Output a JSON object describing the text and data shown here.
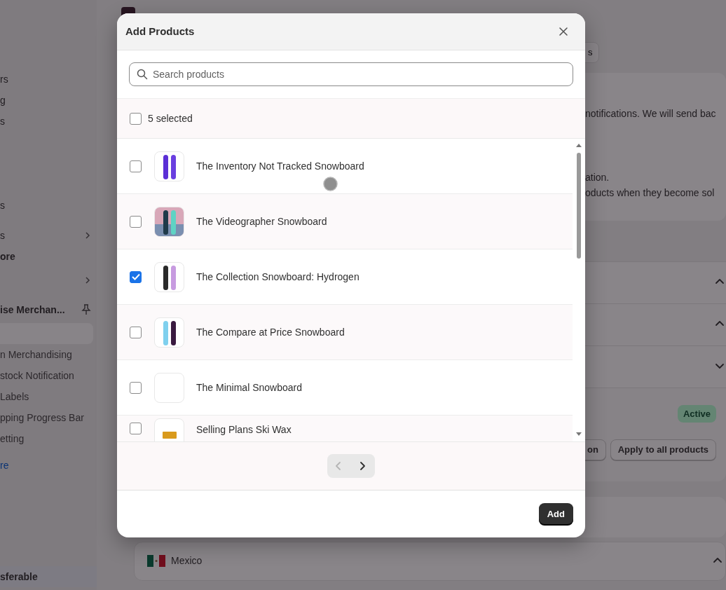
{
  "background": {
    "sidebar_sections": [
      {
        "items": [
          {
            "label": "rs",
            "kind": "item"
          },
          {
            "label": "g",
            "kind": "item"
          },
          {
            "label": "s",
            "kind": "item"
          }
        ]
      },
      {
        "items": [
          {
            "label": "s",
            "kind": "item"
          }
        ]
      },
      {
        "items": [
          {
            "label": "s",
            "kind": "expand"
          },
          {
            "label": "ore",
            "kind": "bold"
          }
        ]
      },
      {
        "items": [
          {
            "kind": "expand"
          },
          {
            "label": "ise Merchan...",
            "kind": "app"
          },
          {
            "kind": "current"
          },
          {
            "label": "n Merchandising",
            "kind": "sub"
          },
          {
            "label": "stock Notification",
            "kind": "sub"
          },
          {
            "label": "Labels",
            "kind": "sub"
          },
          {
            "label": "pping Progress Bar",
            "kind": "sub"
          },
          {
            "label": "etting",
            "kind": "sub"
          }
        ]
      },
      {
        "items": [
          {
            "label": "re",
            "kind": "link"
          }
        ]
      },
      {
        "items": [
          {
            "label": "sferable",
            "kind": "current-bold"
          }
        ]
      }
    ],
    "page_button": "s",
    "notice_lines": [
      "notifications. We will send bac",
      "ation.",
      "oducts when they become sol"
    ],
    "sections": [
      {
        "expanded": true
      },
      {
        "expanded": true
      },
      {
        "expanded": false
      }
    ],
    "status_badge": "Active",
    "buttons": [
      "on",
      "Apply to all products"
    ],
    "country": "Mexico"
  },
  "modal": {
    "title": "Add Products",
    "search": {
      "placeholder": "Search products"
    },
    "select_all": {
      "checked": false,
      "label": "5 selected"
    },
    "products": [
      {
        "name": "The Inventory Not Tracked Snowboard",
        "checked": false,
        "kind": "picture"
      },
      {
        "name": "The Videographer Snowboard",
        "checked": false,
        "kind": "picture"
      },
      {
        "name": "The Collection Snowboard: Hydrogen",
        "checked": true,
        "kind": "picture"
      },
      {
        "name": "The Compare at Price Snowboard",
        "checked": false,
        "kind": "picture"
      },
      {
        "name": "The Minimal Snowboard",
        "checked": false,
        "kind": "blank"
      },
      {
        "name": "Selling Plans Ski Wax",
        "checked": false,
        "kind": "picture"
      }
    ],
    "pagination": {
      "previous_disabled": true,
      "next_disabled": false
    },
    "submit": "Add"
  }
}
